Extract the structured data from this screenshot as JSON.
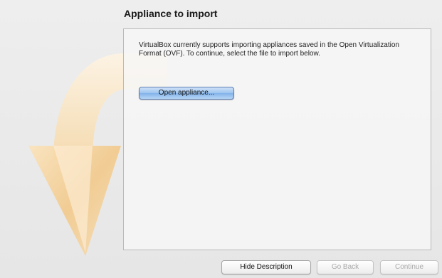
{
  "page": {
    "title": "Appliance to import"
  },
  "panel": {
    "description": "VirtualBox currently supports importing appliances saved in the Open Virtualization Format (OVF). To continue, select the file to import below.",
    "open_button_label": "Open appliance..."
  },
  "footer": {
    "hide_description_label": "Hide Description",
    "go_back_label": "Go Back",
    "continue_label": "Continue"
  },
  "backdrop": {
    "icon": "import-arrow-icon",
    "color": "#f2c98a"
  }
}
